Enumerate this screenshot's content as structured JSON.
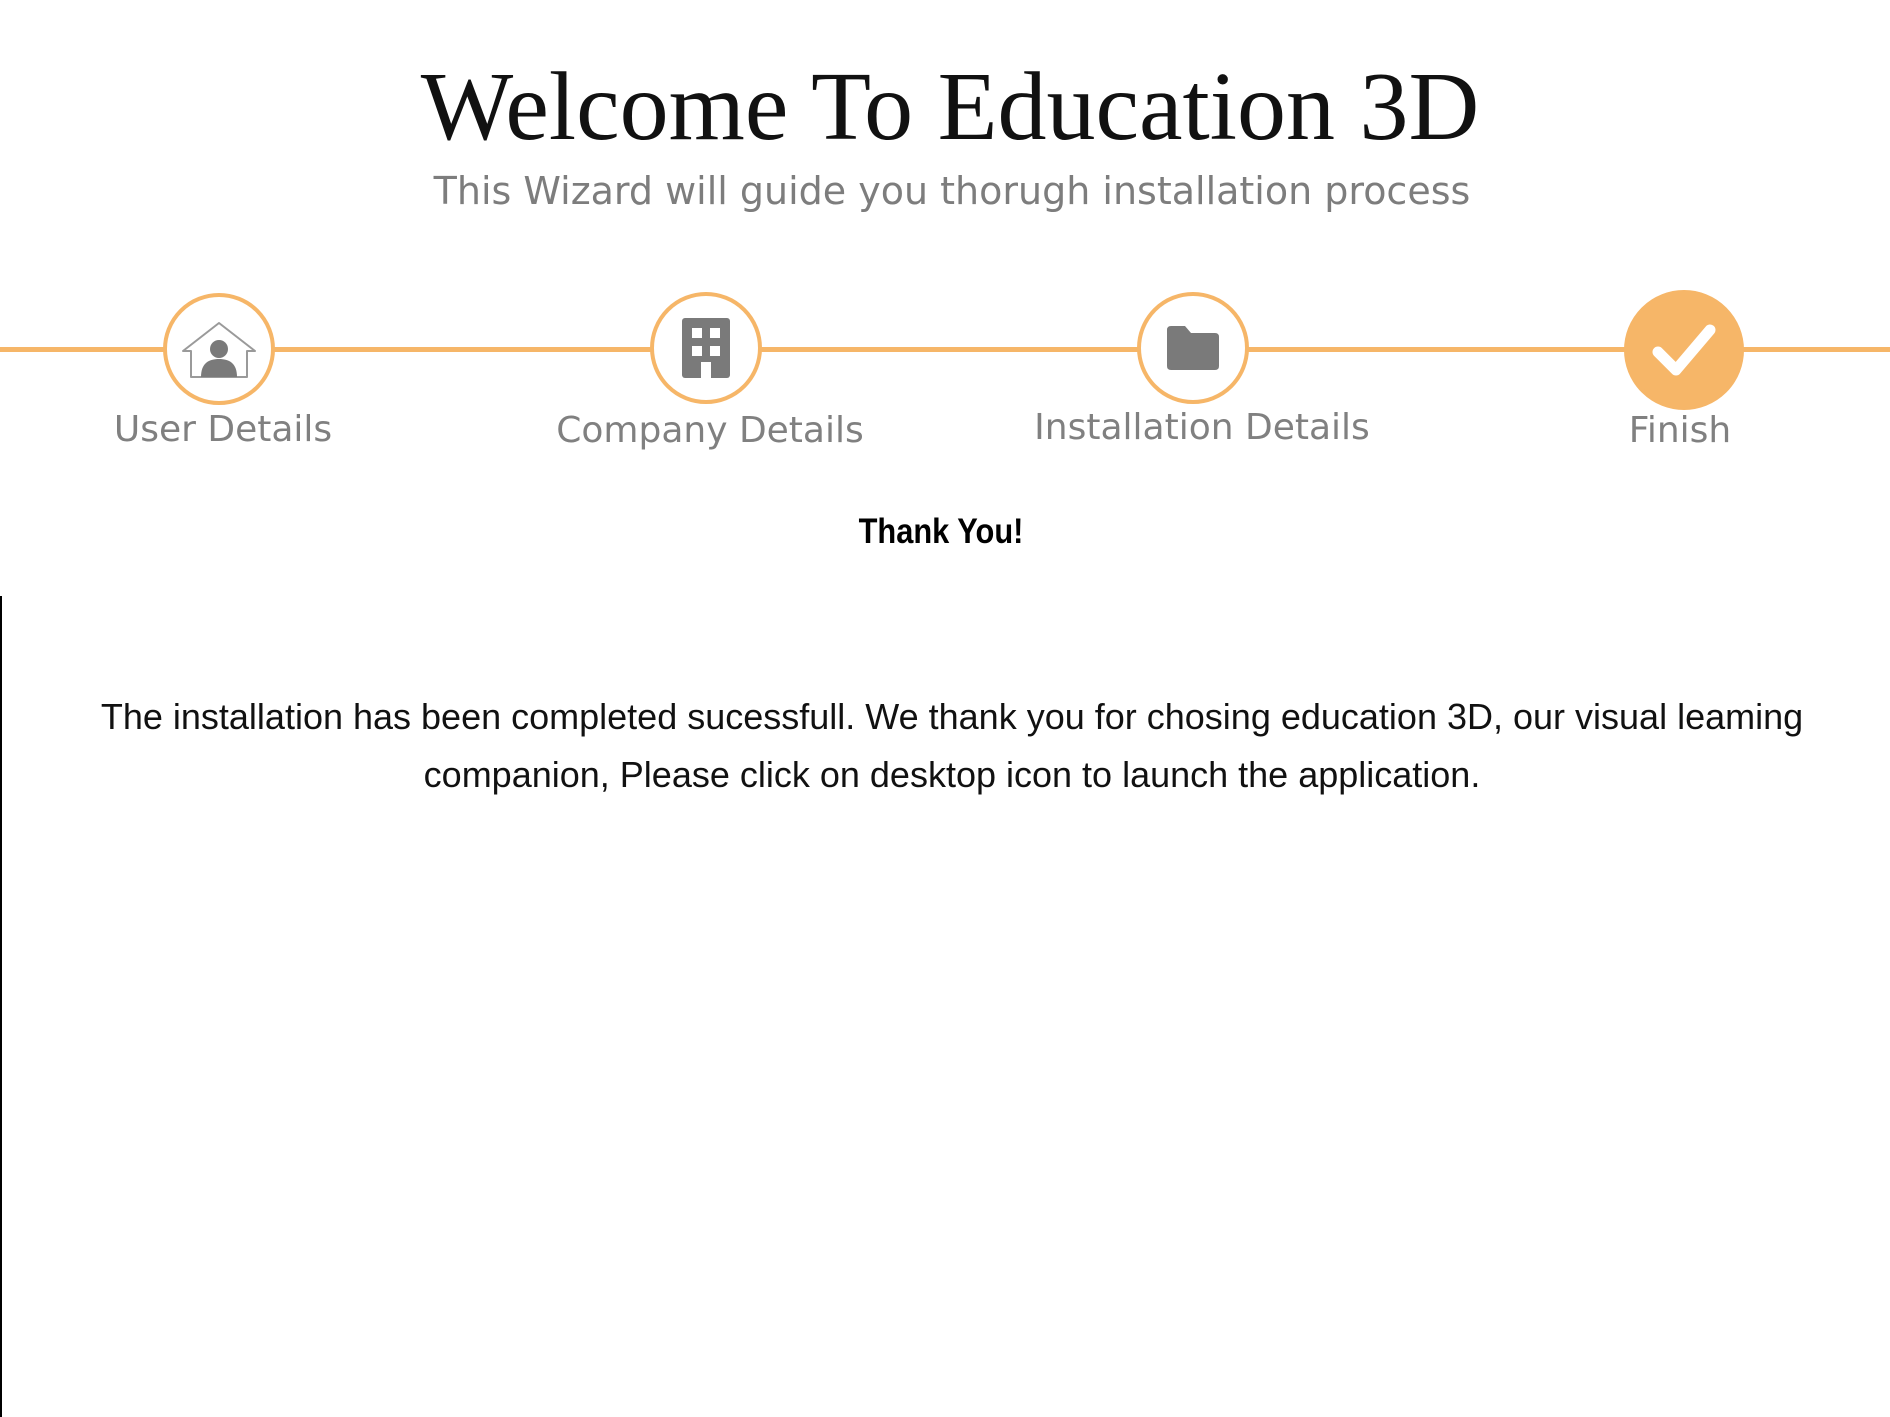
{
  "header": {
    "title": "Welcome To Education 3D",
    "subtitle": "This Wizard will guide you thorugh installation process"
  },
  "wizard": {
    "accent_color": "#f6b668",
    "icon_color": "#7a7a7a",
    "steps": [
      {
        "label": "User Details",
        "icon": "user-home-icon",
        "status": "completed"
      },
      {
        "label": "Company Details",
        "icon": "building-icon",
        "status": "completed"
      },
      {
        "label": "Installation Details",
        "icon": "folder-icon",
        "status": "completed"
      },
      {
        "label": "Finish",
        "icon": "checkmark-icon",
        "status": "current"
      }
    ]
  },
  "content": {
    "heading": "Thank You!",
    "message": "The installation has been completed sucessfull. We thank you for chosing education 3D, our visual leaming companion, Please click on desktop icon to launch the application."
  }
}
